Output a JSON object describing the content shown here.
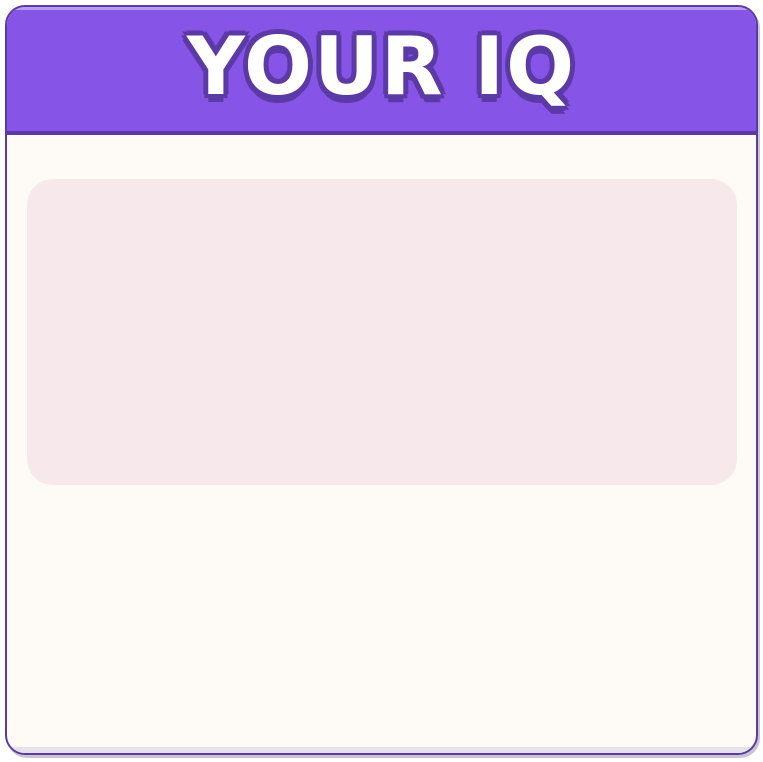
{
  "header": {
    "title": "YOUR IQ"
  },
  "colors": {
    "header_bg": "#8654e6",
    "border": "#5b3aa6",
    "card_bg": "#fefaf5",
    "panel_bg": "#f7e8ec"
  }
}
